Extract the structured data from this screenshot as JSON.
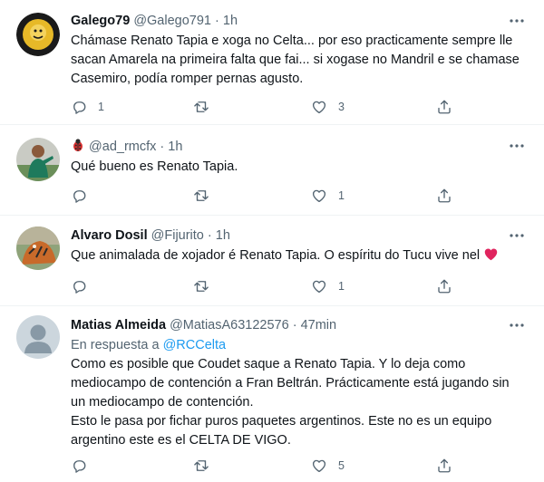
{
  "tweets": [
    {
      "display_name": "Galego79",
      "handle": "@Galego791",
      "time": "1h",
      "text": "Chámase Renato Tapia e xoga no Celta... por eso practicamente sempre lle sacan Amarela na primeira falta que fai... si xogase no Mandril e se chamase Casemiro, podía romper pernas agusto.",
      "replies": "1",
      "retweets": "",
      "likes": "3"
    },
    {
      "display_name": "",
      "handle": "@ad_rmcfx",
      "time": "1h",
      "text": "Qué bueno es Renato Tapia.",
      "replies": "",
      "retweets": "",
      "likes": "1"
    },
    {
      "display_name": "Alvaro Dosil",
      "handle": "@Fijurito",
      "time": "1h",
      "text": "Que animalada de xojador é Renato Tapia. O espíritu do Tucu vive nel",
      "replies": "",
      "retweets": "",
      "likes": "1"
    },
    {
      "display_name": "Matias Almeida",
      "handle": "@MatiasA63122576",
      "time": "47min",
      "replying_label": "En respuesta a",
      "replying_to": "@RCCelta",
      "text_lines": [
        "Como es posible que Coudet saque a Renato Tapia. Y lo deja como",
        "mediocampo de contención a Fran Beltrán. Prácticamente está jugando sin",
        "un mediocampo de contención.",
        "Esto le pasa por fichar puros paquetes argentinos. Este no es un equipo",
        "argentino este es el CELTA DE VIGO."
      ],
      "replies": "",
      "retweets": "",
      "likes": "5"
    }
  ],
  "separator": " · ",
  "colors": {
    "text": "#0f1419",
    "meta": "#536471",
    "link": "#1d9bf0",
    "heart": "#e0245e",
    "divider": "#eff3f4"
  },
  "icons": [
    "reply-icon",
    "retweet-icon",
    "like-icon",
    "share-icon",
    "more-icon",
    "bug-emoji-icon",
    "red-heart-emoji-icon"
  ]
}
